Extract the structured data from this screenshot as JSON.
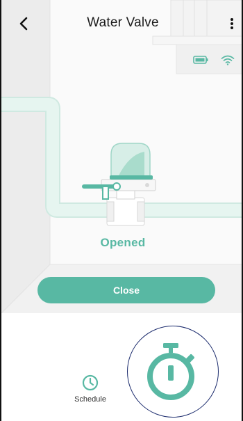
{
  "header": {
    "title": "Water Valve",
    "back_icon": "chevron-left-icon",
    "more_icon": "more-vertical-icon"
  },
  "device_status": {
    "battery_icon": "battery-icon",
    "wifi_icon": "wifi-icon"
  },
  "valve": {
    "state_label": "Opened",
    "action_label": "Close"
  },
  "bottom_bar": {
    "schedule_label": "Schedule",
    "schedule_icon": "clock-icon",
    "timer_icon": "stopwatch-icon"
  },
  "colors": {
    "accent": "#58b8a3",
    "pipe": "#e4f4ef",
    "highlight_ring": "#1a2a6c"
  }
}
